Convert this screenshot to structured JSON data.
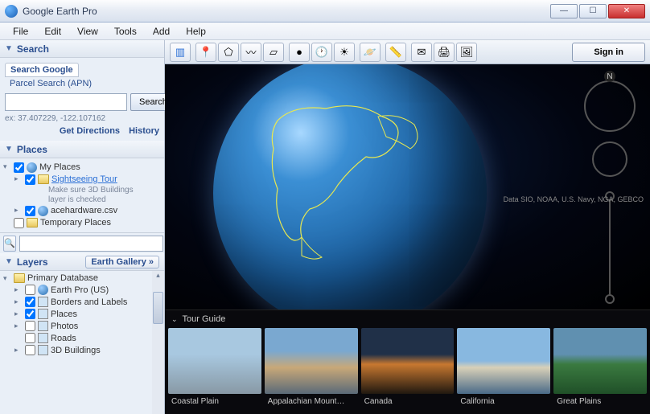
{
  "window": {
    "title": "Google Earth Pro"
  },
  "menu": [
    "File",
    "Edit",
    "View",
    "Tools",
    "Add",
    "Help"
  ],
  "search": {
    "header": "Search",
    "tab1": "Search Google",
    "tab2": "Parcel Search (APN)",
    "button": "Search",
    "example": "ex: 37.407229, -122.107162",
    "directions": "Get Directions",
    "history": "History"
  },
  "places": {
    "header": "Places",
    "myplaces": "My Places",
    "sightseeing": "Sightseeing Tour",
    "sightseeing_sub1": "Make sure 3D Buildings",
    "sightseeing_sub2": "layer is checked",
    "ace": "acehardware.csv",
    "temp": "Temporary Places"
  },
  "layers": {
    "header": "Layers",
    "gallery": "Earth Gallery »",
    "items": [
      "Primary Database",
      "Earth Pro (US)",
      "Borders and Labels",
      "Places",
      "Photos",
      "Roads",
      "3D Buildings"
    ]
  },
  "toolbar": {
    "signin": "Sign in"
  },
  "nav": {
    "n": "N"
  },
  "tour_guide": {
    "header": "Tour Guide",
    "items": [
      "Coastal Plain",
      "Appalachian Mount…",
      "Canada",
      "California",
      "Great Plains"
    ]
  },
  "credits": "Data SIO, NOAA, U.S. Navy, NGA, GEBCO"
}
